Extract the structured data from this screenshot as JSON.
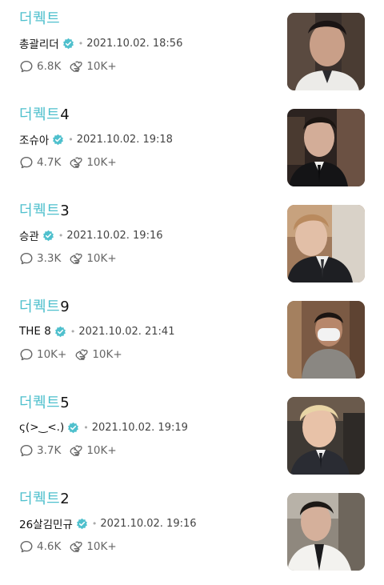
{
  "posts": [
    {
      "kw": "더퀙트",
      "num": "",
      "author": "총괄리더",
      "date": "2021.10.02. 18:56",
      "comments": "6.8K",
      "likes": "10K+"
    },
    {
      "kw": "더퀙트",
      "num": "4",
      "author": "조슈아",
      "date": "2021.10.02. 19:18",
      "comments": "4.7K",
      "likes": "10K+"
    },
    {
      "kw": "더퀙트",
      "num": "3",
      "author": "승관",
      "date": "2021.10.02. 19:16",
      "comments": "3.3K",
      "likes": "10K+"
    },
    {
      "kw": "더퀙트",
      "num": "9",
      "author": "THE 8",
      "date": "2021.10.02. 21:41",
      "comments": "10K+",
      "likes": "10K+"
    },
    {
      "kw": "더퀙트",
      "num": "5",
      "author": "ς(>‿<.)",
      "date": "2021.10.02. 19:19",
      "comments": "3.7K",
      "likes": "10K+"
    },
    {
      "kw": "더퀙트",
      "num": "2",
      "author": "26살김민규",
      "date": "2021.10.02. 19:16",
      "comments": "4.6K",
      "likes": "10K+"
    }
  ],
  "icons": {
    "verified": "verified-badge-icon",
    "comment": "comment-bubble-icon",
    "like": "heart-hands-icon"
  },
  "colors": {
    "accent": "#4fc0cd",
    "verified": "#4fc0cd",
    "meta": "#666666"
  }
}
